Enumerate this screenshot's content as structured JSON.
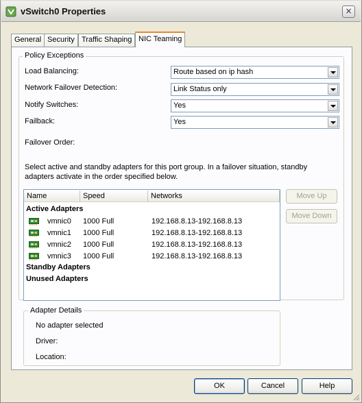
{
  "window": {
    "title": "vSwitch0 Properties",
    "close_glyph": "×"
  },
  "tabs": [
    {
      "label": "General"
    },
    {
      "label": "Security"
    },
    {
      "label": "Traffic Shaping"
    },
    {
      "label": "NIC Teaming",
      "active": true
    }
  ],
  "policy": {
    "legend": "Policy Exceptions",
    "load_balancing": {
      "label": "Load Balancing:",
      "value": "Route based on ip hash"
    },
    "failover_detection": {
      "label": "Network Failover Detection:",
      "value": "Link Status only"
    },
    "notify_switches": {
      "label": "Notify Switches:",
      "value": "Yes"
    },
    "failback": {
      "label": "Failback:",
      "value": "Yes"
    },
    "failover_order_label": "Failover Order:",
    "description_line1": "Select active and standby adapters for this port group.  In a failover situation, standby",
    "description_line2": "adapters activate  in the order specified below."
  },
  "adapters": {
    "columns": [
      "Name",
      "Speed",
      "Networks"
    ],
    "active_heading": "Active Adapters",
    "standby_heading": "Standby Adapters",
    "unused_heading": "Unused Adapters",
    "active": [
      {
        "name": "vmnic0",
        "speed": "1000 Full",
        "networks": "192.168.8.13-192.168.8.13"
      },
      {
        "name": "vmnic1",
        "speed": "1000 Full",
        "networks": "192.168.8.13-192.168.8.13"
      },
      {
        "name": "vmnic2",
        "speed": "1000 Full",
        "networks": "192.168.8.13-192.168.8.13"
      },
      {
        "name": "vmnic3",
        "speed": "1000 Full",
        "networks": "192.168.8.13-192.168.8.13"
      }
    ],
    "icon": "network-adapter-icon"
  },
  "side_buttons": {
    "move_up": "Move Up",
    "move_down": "Move Down"
  },
  "adapter_details": {
    "legend": "Adapter Details",
    "status": "No adapter selected",
    "driver_label": "Driver:",
    "location_label": "Location:"
  },
  "footer": {
    "ok": "OK",
    "cancel": "Cancel",
    "help": "Help"
  },
  "colors": {
    "active_tab_accent": "#e68b2c",
    "panel_bg": "#fcfcfe",
    "dialog_bg": "#ece9d8",
    "field_border": "#7f9db9"
  }
}
